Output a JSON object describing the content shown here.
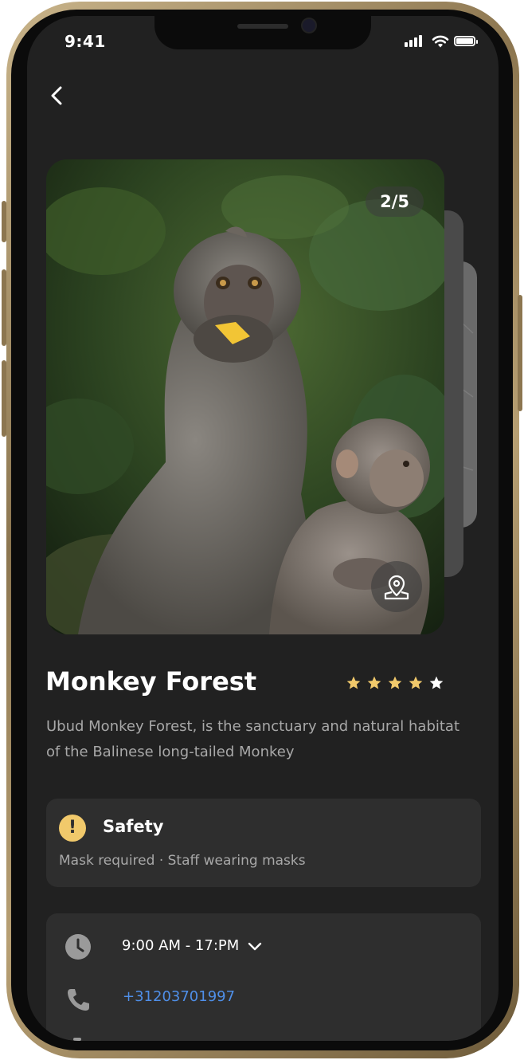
{
  "status_bar": {
    "time": "9:41"
  },
  "nav": {
    "back_icon": "chevron-left-icon"
  },
  "gallery": {
    "counter": "2/5",
    "map_icon": "map-pin-icon"
  },
  "place": {
    "name": "Monkey Forest",
    "rating": 4,
    "rating_max": 5,
    "description": "Ubud Monkey Forest, is the sanctuary and natural habitat of the Balinese long-tailed Monkey"
  },
  "safety": {
    "icon": "alert-icon",
    "title": "Safety",
    "text": "Mask required · Staff wearing masks"
  },
  "info": {
    "hours": "9:00 AM - 17:PM",
    "phone": "+31203701997"
  },
  "colors": {
    "background": "#212121",
    "card": "#2e2e2e",
    "star_filled": "#f1c96b",
    "star_empty": "#ffffff",
    "link": "#4f8fe8",
    "frame_gold": "#b79f73"
  }
}
